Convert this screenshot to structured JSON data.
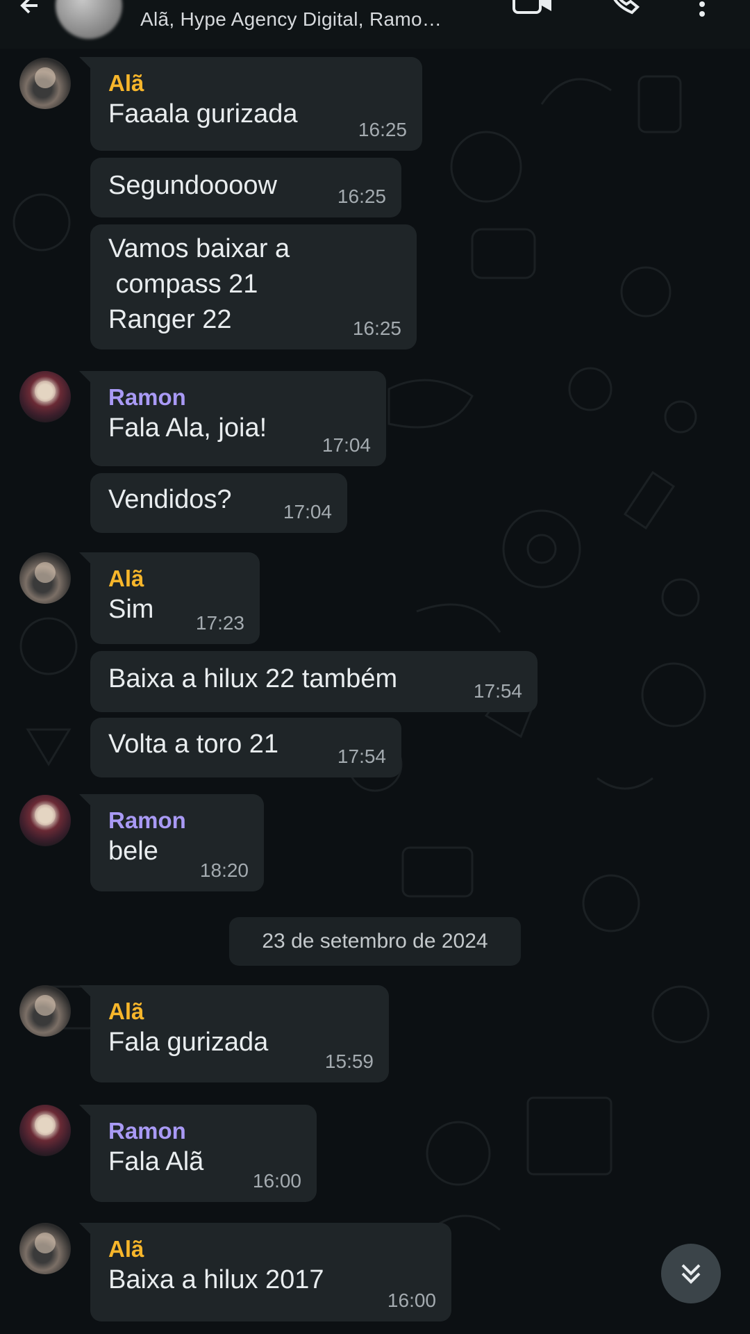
{
  "header": {
    "subtitle": "Alã, Hype Agency Digital, Ramo…",
    "icons": [
      "back-arrow-icon",
      "group-avatar",
      "video-call-icon",
      "voice-call-icon",
      "more-options-icon"
    ]
  },
  "messages": [
    {
      "sender": "Alã",
      "text": "Faaala gurizada",
      "time": "16:25"
    },
    {
      "text": "Segundoooow",
      "time": "16:25"
    },
    {
      "text": "Vamos baixar a\n compass 21\nRanger 22",
      "time": "16:25"
    },
    {
      "sender": "Ramon",
      "text": "Fala Ala, joia!",
      "time": "17:04"
    },
    {
      "text": "Vendidos?",
      "time": "17:04"
    },
    {
      "sender": "Alã",
      "text": "Sim",
      "time": "17:23"
    },
    {
      "text": "Baixa a hilux 22 também",
      "time": "17:54"
    },
    {
      "text": "Volta a toro 21",
      "time": "17:54"
    },
    {
      "sender": "Ramon",
      "text": "bele",
      "time": "18:20"
    },
    {
      "sender": "Alã",
      "text": "Fala gurizada",
      "time": "15:59"
    },
    {
      "sender": "Ramon",
      "text": "Fala Alã",
      "time": "16:00"
    },
    {
      "sender": "Alã",
      "text": "Baixa a hilux 2017",
      "time": "16:00"
    }
  ],
  "date_separator": "23 de setembro de 2024",
  "colors": {
    "background": "#0c1013",
    "bubble": "#1f2528",
    "sender_ala": "#f7b62b",
    "sender_ramon": "#a99af5",
    "timestamp": "#a4abb0"
  }
}
